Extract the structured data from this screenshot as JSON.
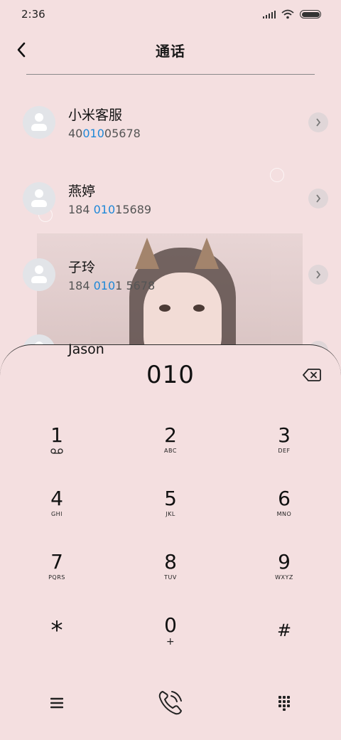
{
  "status_bar": {
    "time": "2:36"
  },
  "header": {
    "title": "通话"
  },
  "contacts": [
    {
      "name": "小米客服",
      "number_before": "40",
      "number_match": "010",
      "number_after": "05678"
    },
    {
      "name": "燕婷",
      "number_before": "184 ",
      "number_match": "010",
      "number_after": "15689"
    },
    {
      "name": "子玲",
      "number_before": "184 ",
      "number_match": "010",
      "number_after": "1 5678"
    },
    {
      "name": "Jason",
      "number_before": "",
      "number_match": "",
      "number_after": ""
    }
  ],
  "dialpad": {
    "entered": "010",
    "keys": [
      [
        {
          "digit": "1",
          "letters": ""
        },
        {
          "digit": "2",
          "letters": "ABC"
        },
        {
          "digit": "3",
          "letters": "DEF"
        }
      ],
      [
        {
          "digit": "4",
          "letters": "GHI"
        },
        {
          "digit": "5",
          "letters": "JKL"
        },
        {
          "digit": "6",
          "letters": "MNO"
        }
      ],
      [
        {
          "digit": "7",
          "letters": "PQRS"
        },
        {
          "digit": "8",
          "letters": "TUV"
        },
        {
          "digit": "9",
          "letters": "WXYZ"
        }
      ],
      [
        {
          "digit": "*",
          "letters": ""
        },
        {
          "digit": "0",
          "letters": "+"
        },
        {
          "digit": "#",
          "letters": ""
        }
      ]
    ]
  },
  "icons": {
    "back": "chevron-left-icon",
    "backspace": "backspace-icon",
    "voicemail": "voicemail-icon",
    "menu": "menu-icon",
    "call": "phone-call-icon",
    "keypad": "keypad-icon"
  },
  "colors": {
    "background": "#f4dfe0",
    "highlight": "#1e88d8"
  }
}
